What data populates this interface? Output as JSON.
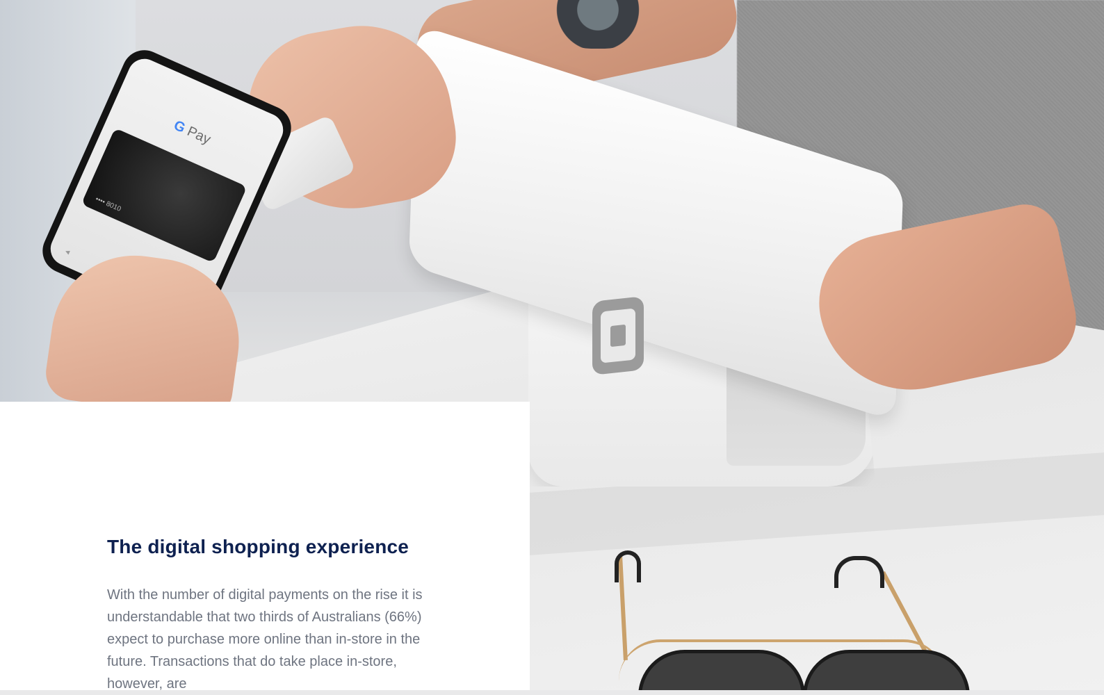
{
  "photo": {
    "alt": "Customer paying with a phone at a point-of-sale terminal",
    "phone_app_label": "Pay",
    "phone_app_initial": "G",
    "card_number": "•••• 8010",
    "phone_nav": "◂ ● ▪",
    "terminal_logo": "square-icon"
  },
  "article": {
    "heading": "The digital shopping experience",
    "body": "With the number of digital payments on the rise it is understandable that two thirds of Australians (66%) expect to purchase more online than in-store in the future. Transactions that do take place in-store, however, are"
  },
  "colors": {
    "heading": "#0e2150",
    "body_text": "#6e7480",
    "panel_bg": "#ffffff"
  }
}
